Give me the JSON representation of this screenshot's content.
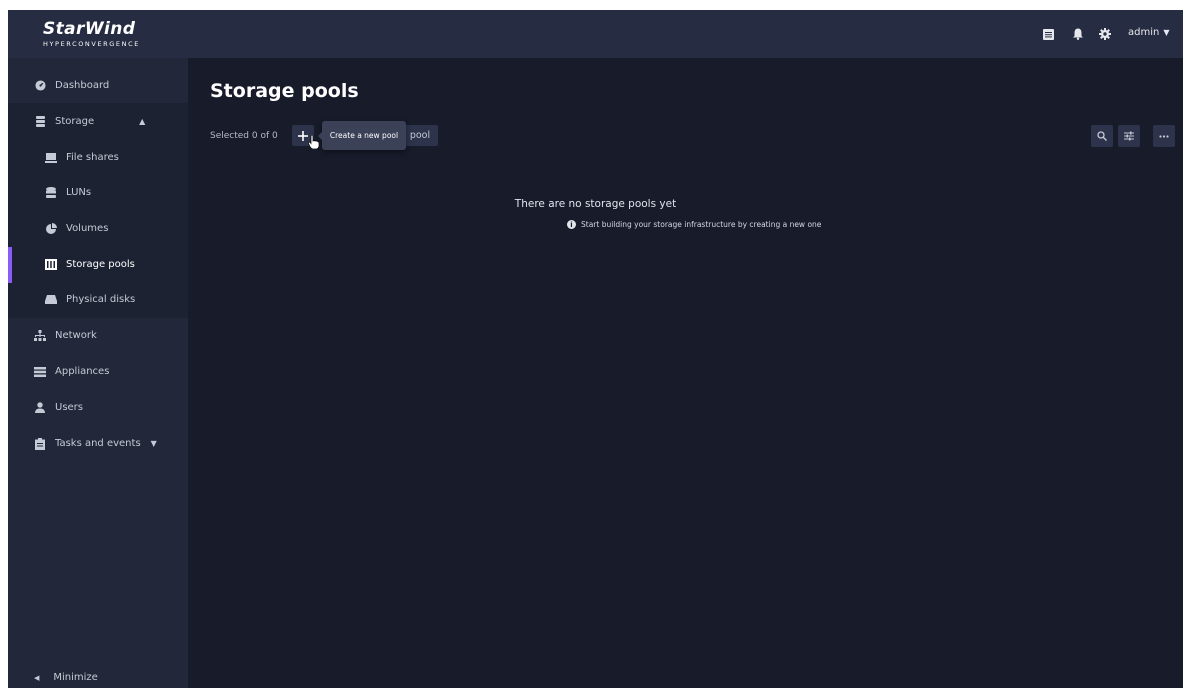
{
  "brand": {
    "name": "StarWind",
    "subtitle": "HYPERCONVERGENCE"
  },
  "sidebar": {
    "items": [
      {
        "label": "Dashboard",
        "icon": "dashboard-icon"
      },
      {
        "label": "Storage",
        "icon": "database-icon",
        "expanded": true
      },
      {
        "label": "File shares",
        "icon": "file-shares-icon"
      },
      {
        "label": "LUNs",
        "icon": "luns-icon"
      },
      {
        "label": "Volumes",
        "icon": "pie-icon"
      },
      {
        "label": "Storage pools",
        "icon": "storage-pools-icon",
        "active": true
      },
      {
        "label": "Physical disks",
        "icon": "disk-icon"
      },
      {
        "label": "Network",
        "icon": "network-icon"
      },
      {
        "label": "Appliances",
        "icon": "appliances-icon"
      },
      {
        "label": "Users",
        "icon": "user-icon"
      },
      {
        "label": "Tasks and events",
        "icon": "clipboard-icon",
        "expanded": false
      }
    ],
    "minimize_label": "Minimize"
  },
  "topbar": {
    "user": "admin"
  },
  "main": {
    "title": "Storage pools",
    "selected_text": "Selected 0 of 0",
    "pool_button_label": "pool",
    "tooltip": "Create a new pool",
    "empty_title": "There are no storage pools yet",
    "empty_subtitle": "Start building your storage infrastructure by creating a new one"
  },
  "colors": {
    "accent": "#8a5cf6",
    "background": "#171b2a",
    "sidebar": "#222839",
    "topbar": "#262d42"
  }
}
